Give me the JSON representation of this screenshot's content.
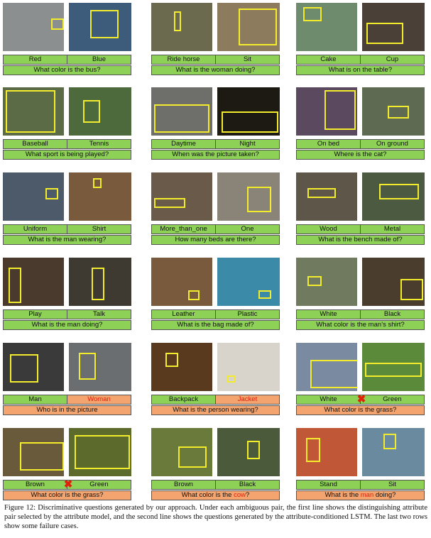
{
  "caption": "Figure 12: Discriminative questions generated by our approach. Under each ambiguous pair, the first line shows the distinguishing attribute pair selected by the attribute model, and the second line shows the questions generated by the attribute-conditioned LSTM. The last two rows show some failure cases.",
  "colors": {
    "success": "#8ed157",
    "failure": "#f4a46e",
    "error_text": "#e0210c",
    "bbox": "#f2ec2c"
  },
  "examples": [
    {
      "attr_left": "Red",
      "attr_right": "Blue",
      "question": "What color is the bus?",
      "status": "success"
    },
    {
      "attr_left": "Ride horse",
      "attr_right": "Sit",
      "question": "What is the woman doing?",
      "status": "success"
    },
    {
      "attr_left": "Cake",
      "attr_right": "Cup",
      "question": "What is on the table?",
      "status": "success"
    },
    {
      "attr_left": "Baseball",
      "attr_right": "Tennis",
      "question": "What sport is being played?",
      "status": "success"
    },
    {
      "attr_left": "Daytime",
      "attr_right": "Night",
      "question": "When was the picture taken?",
      "status": "success"
    },
    {
      "attr_left": "On bed",
      "attr_right": "On ground",
      "question": "Where is the cat?",
      "status": "success"
    },
    {
      "attr_left": "Uniform",
      "attr_right": "Shirt",
      "question": "What is the man wearing?",
      "status": "success"
    },
    {
      "attr_left": "More_than_one",
      "attr_right": "One",
      "question": "How many beds are there?",
      "status": "success"
    },
    {
      "attr_left": "Wood",
      "attr_right": "Metal",
      "question": "What is the bench made of?",
      "status": "success"
    },
    {
      "attr_left": "Play",
      "attr_right": "Talk",
      "question": "What is the man doing?",
      "status": "success"
    },
    {
      "attr_left": "Leather",
      "attr_right": "Plastic",
      "question": "What is the bag made of?",
      "status": "success"
    },
    {
      "attr_left": "White",
      "attr_right": "Black",
      "question": "What color is the man’s shirt?",
      "status": "success"
    },
    {
      "attr_left": "Man",
      "attr_right": "Woman",
      "question": "Who is in the picture",
      "status": "failure",
      "wrong_attr": "right"
    },
    {
      "attr_left": "Backpack",
      "attr_right": "Jacket",
      "question": "What is the person wearing?",
      "status": "failure",
      "wrong_attr": "right"
    },
    {
      "attr_left": "White",
      "attr_right": "Green",
      "question": "What color is the grass?",
      "status": "failure",
      "xmark": true
    },
    {
      "attr_left": "Brown",
      "attr_right": "Green",
      "question": "What color is the grass?",
      "status": "failure",
      "xmark": true
    },
    {
      "attr_left": "Brown",
      "attr_right": "Black",
      "question_pre": "What color is the ",
      "question_hl": "cow",
      "question_post": "?",
      "status": "failure"
    },
    {
      "attr_left": "Stand",
      "attr_right": "Sit",
      "question_pre": "What is the ",
      "question_hl": "man",
      "question_post": " doing?",
      "status": "failure"
    }
  ]
}
